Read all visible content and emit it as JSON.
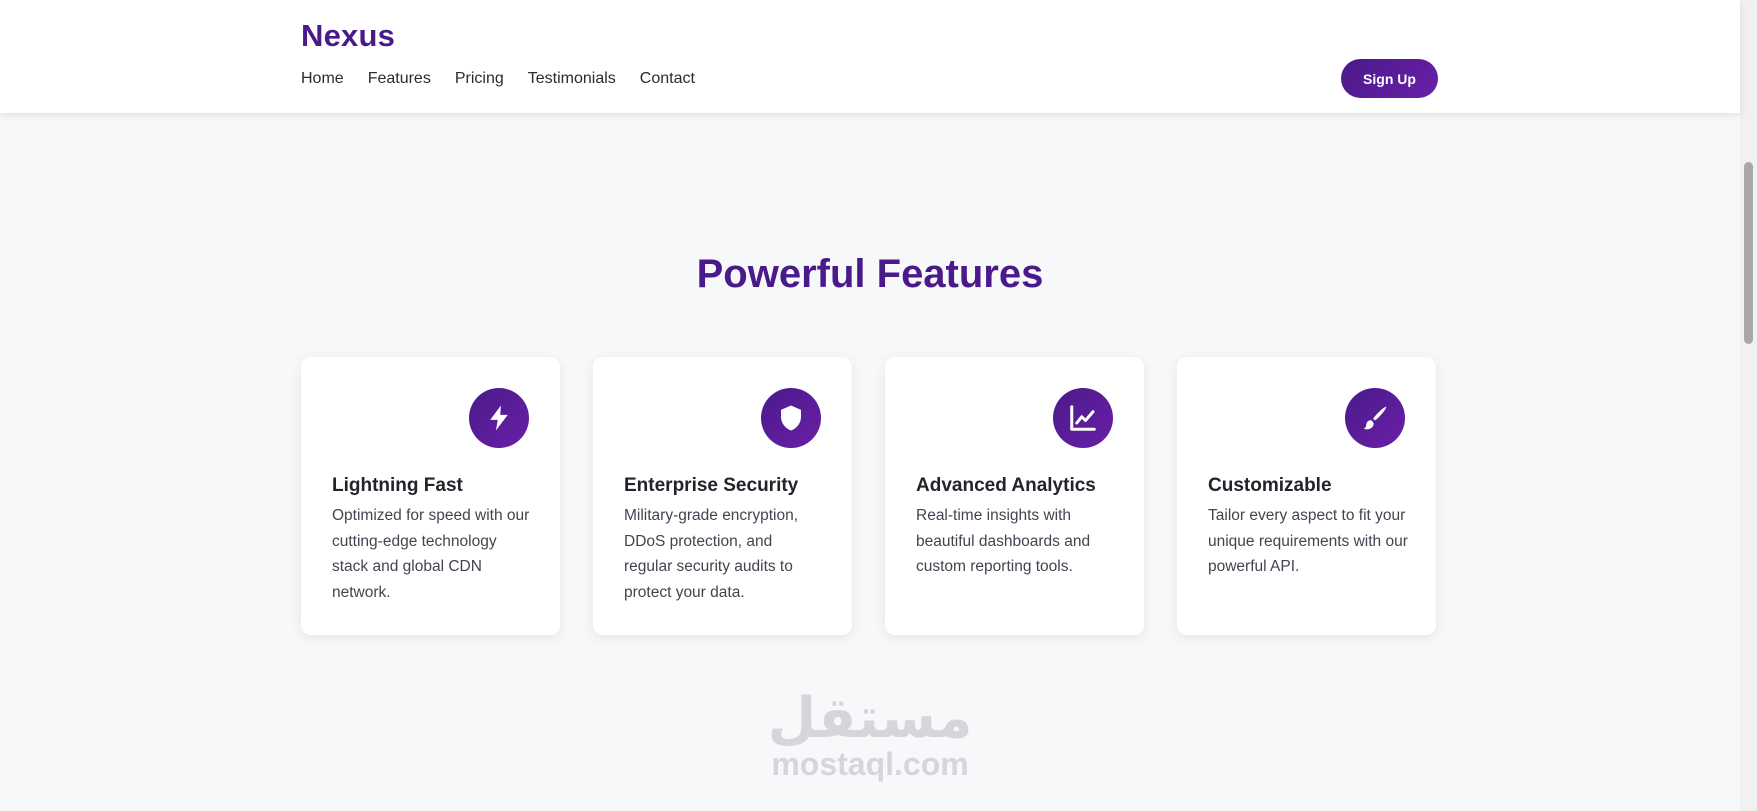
{
  "header": {
    "logo": "Nexus",
    "nav": [
      "Home",
      "Features",
      "Pricing",
      "Testimonials",
      "Contact"
    ],
    "signup_label": "Sign Up"
  },
  "section": {
    "title": "Powerful Features"
  },
  "features": [
    {
      "icon": "lightning-bolt-icon",
      "title": "Lightning Fast",
      "description": "Optimized for speed with our cutting-edge technology stack and global CDN network."
    },
    {
      "icon": "shield-icon",
      "title": "Enterprise Security",
      "description": "Military-grade encryption, DDoS protection, and regular security audits to protect your data."
    },
    {
      "icon": "line-chart-icon",
      "title": "Advanced Analytics",
      "description": "Real-time insights with beautiful dashboards and custom reporting tools."
    },
    {
      "icon": "paint-brush-icon",
      "title": "Customizable",
      "description": "Tailor every aspect to fit your unique requirements with our powerful API."
    }
  ],
  "watermark": {
    "arabic": "مستقل",
    "latin": "mostaql.com"
  },
  "colors": {
    "brand": "#4a1a8a",
    "accent": "#6a1fa8",
    "background": "#f7f8fa"
  }
}
